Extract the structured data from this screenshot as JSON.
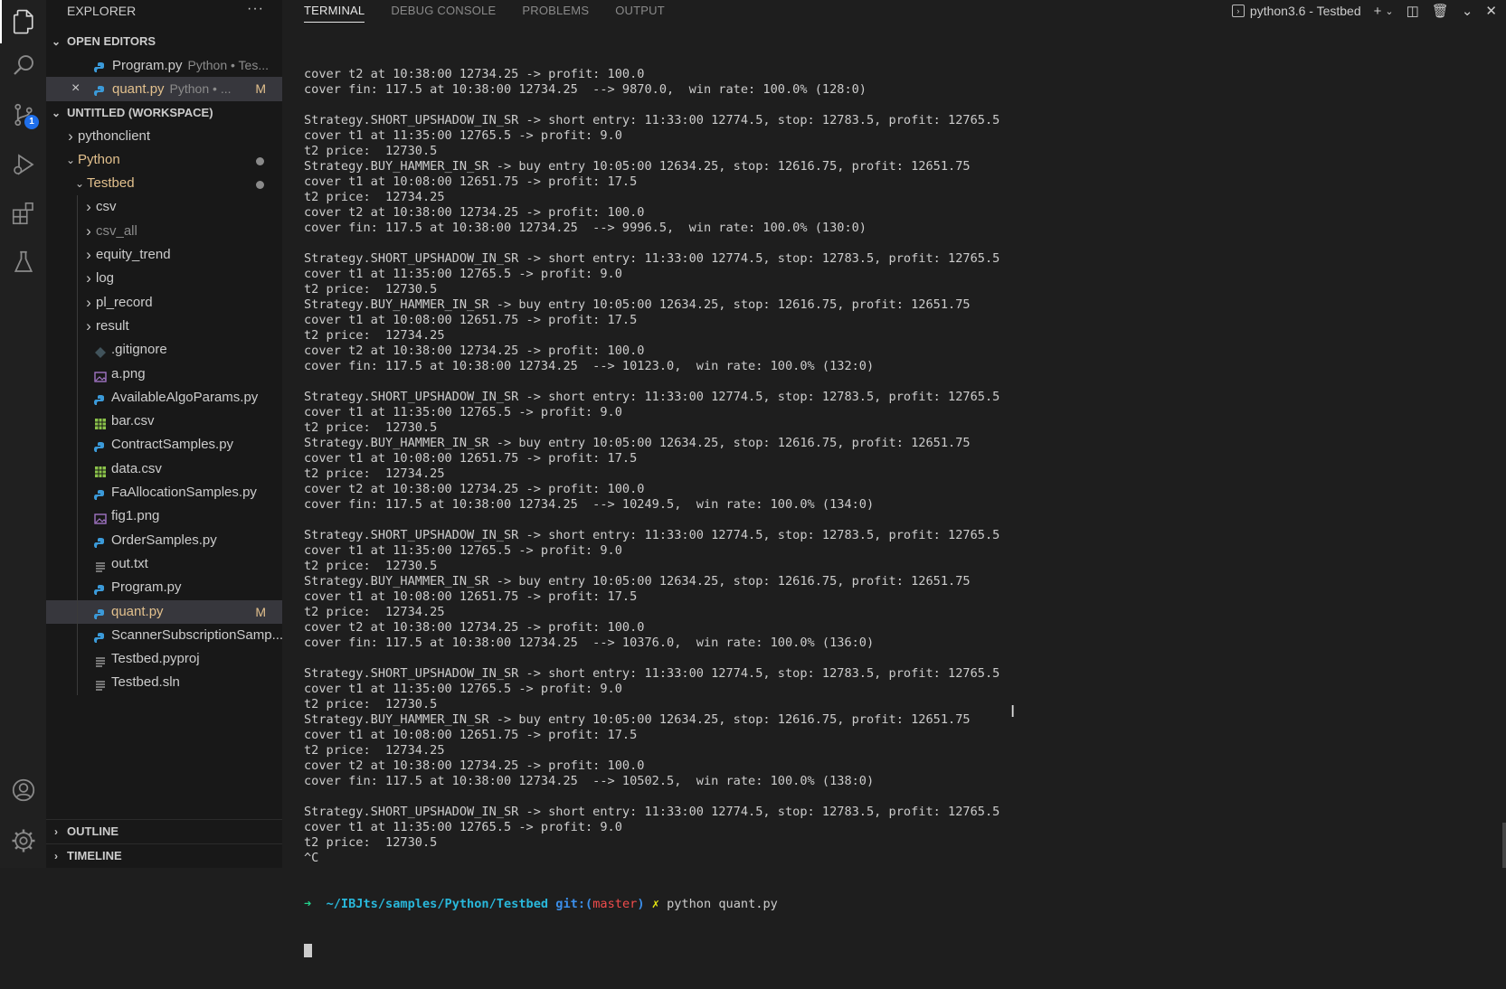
{
  "sidebar": {
    "title": "EXPLORER",
    "more": "···",
    "open_editors": {
      "label": "OPEN EDITORS",
      "items": [
        {
          "name": "Program.py",
          "desc": "Python • Tes..."
        },
        {
          "name": "quant.py",
          "desc": "Python • ...",
          "mark": "M"
        }
      ]
    },
    "workspace": {
      "label": "UNTITLED (WORKSPACE)",
      "items": [
        {
          "name": "pythonclient",
          "kind": "folder",
          "depth": 0
        },
        {
          "name": "Python",
          "kind": "folder-open",
          "depth": 0,
          "mod": true
        },
        {
          "name": "Testbed",
          "kind": "folder-open",
          "depth": 1,
          "mod": true
        },
        {
          "name": "csv",
          "kind": "folder",
          "depth": 2
        },
        {
          "name": "csv_all",
          "kind": "folder",
          "depth": 2,
          "dim": true
        },
        {
          "name": "equity_trend",
          "kind": "folder",
          "depth": 2
        },
        {
          "name": "log",
          "kind": "folder",
          "depth": 2
        },
        {
          "name": "pl_record",
          "kind": "folder",
          "depth": 2
        },
        {
          "name": "result",
          "kind": "folder",
          "depth": 2
        },
        {
          "name": ".gitignore",
          "kind": "git",
          "depth": 2
        },
        {
          "name": "a.png",
          "kind": "image",
          "depth": 2
        },
        {
          "name": "AvailableAlgoParams.py",
          "kind": "python",
          "depth": 2
        },
        {
          "name": "bar.csv",
          "kind": "csv",
          "depth": 2
        },
        {
          "name": "ContractSamples.py",
          "kind": "python",
          "depth": 2
        },
        {
          "name": "data.csv",
          "kind": "csv",
          "depth": 2
        },
        {
          "name": "FaAllocationSamples.py",
          "kind": "python",
          "depth": 2
        },
        {
          "name": "fig1.png",
          "kind": "image",
          "depth": 2
        },
        {
          "name": "OrderSamples.py",
          "kind": "python",
          "depth": 2
        },
        {
          "name": "out.txt",
          "kind": "text",
          "depth": 2
        },
        {
          "name": "Program.py",
          "kind": "python",
          "depth": 2
        },
        {
          "name": "quant.py",
          "kind": "python",
          "depth": 2,
          "mark": "M",
          "selected": true
        },
        {
          "name": "ScannerSubscriptionSamp...",
          "kind": "python",
          "depth": 2
        },
        {
          "name": "Testbed.pyproj",
          "kind": "text",
          "depth": 2
        },
        {
          "name": "Testbed.sln",
          "kind": "text",
          "depth": 2
        }
      ]
    },
    "outline": "OUTLINE",
    "timeline": "TIMELINE"
  },
  "activity": {
    "items": [
      "files-icon",
      "search-icon",
      "source-control-icon",
      "run-debug-icon",
      "extensions-icon",
      "testing-icon"
    ],
    "scm_badge": "1",
    "bottom": [
      "account-icon",
      "settings-gear-icon"
    ]
  },
  "panel": {
    "tabs": [
      "TERMINAL",
      "DEBUG CONSOLE",
      "PROBLEMS",
      "OUTPUT"
    ],
    "active_tab": "TERMINAL",
    "terminal_name": "python3.6 - Testbed"
  },
  "terminal": {
    "lines": [
      "cover t2 at 10:38:00 12734.25 -> profit: 100.0",
      "cover fin: 117.5 at 10:38:00 12734.25  --> 9870.0,  win rate: 100.0% (128:0)",
      "",
      "Strategy.SHORT_UPSHADOW_IN_SR -> short entry: 11:33:00 12774.5, stop: 12783.5, profit: 12765.5",
      "cover t1 at 11:35:00 12765.5 -> profit: 9.0",
      "t2 price:  12730.5",
      "Strategy.BUY_HAMMER_IN_SR -> buy entry 10:05:00 12634.25, stop: 12616.75, profit: 12651.75",
      "cover t1 at 10:08:00 12651.75 -> profit: 17.5",
      "t2 price:  12734.25",
      "cover t2 at 10:38:00 12734.25 -> profit: 100.0",
      "cover fin: 117.5 at 10:38:00 12734.25  --> 9996.5,  win rate: 100.0% (130:0)",
      "",
      "Strategy.SHORT_UPSHADOW_IN_SR -> short entry: 11:33:00 12774.5, stop: 12783.5, profit: 12765.5",
      "cover t1 at 11:35:00 12765.5 -> profit: 9.0",
      "t2 price:  12730.5",
      "Strategy.BUY_HAMMER_IN_SR -> buy entry 10:05:00 12634.25, stop: 12616.75, profit: 12651.75",
      "cover t1 at 10:08:00 12651.75 -> profit: 17.5",
      "t2 price:  12734.25",
      "cover t2 at 10:38:00 12734.25 -> profit: 100.0",
      "cover fin: 117.5 at 10:38:00 12734.25  --> 10123.0,  win rate: 100.0% (132:0)",
      "",
      "Strategy.SHORT_UPSHADOW_IN_SR -> short entry: 11:33:00 12774.5, stop: 12783.5, profit: 12765.5",
      "cover t1 at 11:35:00 12765.5 -> profit: 9.0",
      "t2 price:  12730.5",
      "Strategy.BUY_HAMMER_IN_SR -> buy entry 10:05:00 12634.25, stop: 12616.75, profit: 12651.75",
      "cover t1 at 10:08:00 12651.75 -> profit: 17.5",
      "t2 price:  12734.25",
      "cover t2 at 10:38:00 12734.25 -> profit: 100.0",
      "cover fin: 117.5 at 10:38:00 12734.25  --> 10249.5,  win rate: 100.0% (134:0)",
      "",
      "Strategy.SHORT_UPSHADOW_IN_SR -> short entry: 11:33:00 12774.5, stop: 12783.5, profit: 12765.5",
      "cover t1 at 11:35:00 12765.5 -> profit: 9.0",
      "t2 price:  12730.5",
      "Strategy.BUY_HAMMER_IN_SR -> buy entry 10:05:00 12634.25, stop: 12616.75, profit: 12651.75",
      "cover t1 at 10:08:00 12651.75 -> profit: 17.5",
      "t2 price:  12734.25",
      "cover t2 at 10:38:00 12734.25 -> profit: 100.0",
      "cover fin: 117.5 at 10:38:00 12734.25  --> 10376.0,  win rate: 100.0% (136:0)",
      "",
      "Strategy.SHORT_UPSHADOW_IN_SR -> short entry: 11:33:00 12774.5, stop: 12783.5, profit: 12765.5",
      "cover t1 at 11:35:00 12765.5 -> profit: 9.0",
      "t2 price:  12730.5",
      "Strategy.BUY_HAMMER_IN_SR -> buy entry 10:05:00 12634.25, stop: 12616.75, profit: 12651.75",
      "cover t1 at 10:08:00 12651.75 -> profit: 17.5",
      "t2 price:  12734.25",
      "cover t2 at 10:38:00 12734.25 -> profit: 100.0",
      "cover fin: 117.5 at 10:38:00 12734.25  --> 10502.5,  win rate: 100.0% (138:0)",
      "",
      "Strategy.SHORT_UPSHADOW_IN_SR -> short entry: 11:33:00 12774.5, stop: 12783.5, profit: 12765.5",
      "cover t1 at 11:35:00 12765.5 -> profit: 9.0",
      "t2 price:  12730.5",
      "^C"
    ],
    "prompt": {
      "arrow": "➜",
      "path": "~/IBJts/samples/Python/Testbed",
      "git": "git:(",
      "branch": "master",
      "git_close": ")",
      "dirty": "✗",
      "command": "python quant.py"
    }
  },
  "colors": {
    "python_icon": "#3b9ad9",
    "csv_icon": "#8bc34a",
    "image_icon": "#a074c4",
    "modified": "#e2c08d"
  }
}
